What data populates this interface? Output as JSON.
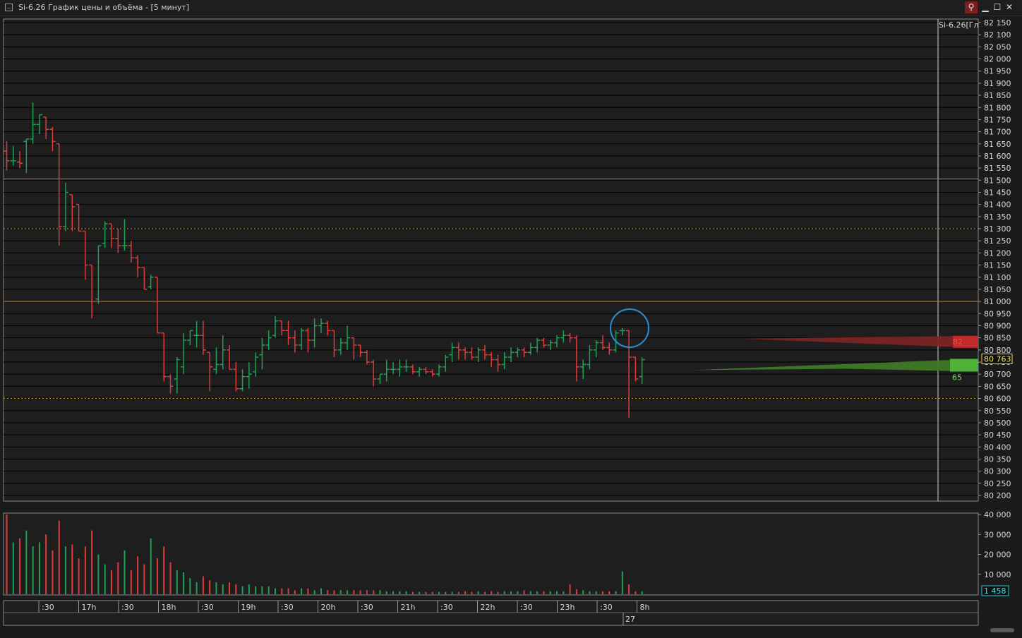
{
  "window": {
    "title": "Si-6.26 График цены и объёма - [5 минут]",
    "buttons": [
      "link-icon",
      "minimize-icon",
      "maximize-icon",
      "close-icon"
    ]
  },
  "colors": {
    "background": "#1b1b1b",
    "up": "#1fa055",
    "down": "#e03a3a",
    "level": "#c87a20",
    "dotted_level": "#d49a2a",
    "grid": "#000000",
    "price_tag_border": "#e8e040",
    "volume_tag": "#22c8d8",
    "circle": "#2a8fd6"
  },
  "chart_data": [
    {
      "type": "ohlc",
      "label": "Si-6.26[Гл",
      "ylim": [
        80200,
        82150
      ],
      "y_ticks": [
        "82 150",
        "82 100",
        "82 050",
        "82 000",
        "81 950",
        "81 900",
        "81 850",
        "81 800",
        "81 750",
        "81 700",
        "81 650",
        "81 600",
        "81 550",
        "81 500",
        "81 450",
        "81 400",
        "81 350",
        "81 300",
        "81 250",
        "81 200",
        "81 150",
        "81 100",
        "81 050",
        "81 000",
        "80 950",
        "80 900",
        "80 850",
        "80 800",
        "80 750",
        "80 700",
        "80 650",
        "80 600",
        "80 550",
        "80 500",
        "80 450",
        "80 400",
        "80 350",
        "80 300",
        "80 250",
        "80 200"
      ],
      "last_price": "80 763",
      "horizontal_levels": [
        {
          "price": 81505,
          "style": "solid"
        },
        {
          "price": 81000,
          "style": "solid"
        },
        {
          "price": 81300,
          "style": "dotted"
        },
        {
          "price": 80600,
          "style": "dotted"
        }
      ],
      "volume_profile": [
        {
          "label": "82",
          "side": "sell"
        },
        {
          "label": "65",
          "side": "buy"
        }
      ],
      "bars": [
        [
          81620,
          81660,
          81540,
          81580
        ],
        [
          81580,
          81640,
          81560,
          81580
        ],
        [
          81575,
          81620,
          81550,
          81570
        ],
        [
          81660,
          81670,
          81530,
          81670
        ],
        [
          81670,
          81820,
          81650,
          81730
        ],
        [
          81730,
          81770,
          81690,
          81770
        ],
        [
          81760,
          81760,
          81670,
          81710
        ],
        [
          81710,
          81720,
          81620,
          81660
        ],
        [
          81650,
          81650,
          81230,
          81310
        ],
        [
          81310,
          81490,
          81290,
          81450
        ],
        [
          81440,
          81440,
          81290,
          81390
        ],
        [
          81400,
          81400,
          81290,
          81290
        ],
        [
          81290,
          81290,
          81090,
          81150
        ],
        [
          81150,
          81150,
          80930,
          81000
        ],
        [
          81010,
          81230,
          80990,
          81230
        ],
        [
          81240,
          81330,
          81220,
          81320
        ],
        [
          81320,
          81320,
          81220,
          81260
        ],
        [
          81260,
          81300,
          81200,
          81230
        ],
        [
          81230,
          81340,
          81210,
          81230
        ],
        [
          81230,
          81250,
          81160,
          81180
        ],
        [
          81180,
          81190,
          81100,
          81140
        ],
        [
          81140,
          81140,
          81050,
          81050
        ],
        [
          81060,
          81110,
          81050,
          81100
        ],
        [
          81100,
          81100,
          80870,
          80870
        ],
        [
          80870,
          80870,
          80670,
          80690
        ],
        [
          80690,
          80700,
          80620,
          80650
        ],
        [
          80680,
          80770,
          80620,
          80760
        ],
        [
          80730,
          80870,
          80700,
          80840
        ],
        [
          80840,
          80880,
          80820,
          80880
        ],
        [
          80860,
          80920,
          80810,
          80860
        ],
        [
          80860,
          80920,
          80780,
          80800
        ],
        [
          80790,
          80790,
          80630,
          80730
        ],
        [
          80720,
          80810,
          80700,
          80740
        ],
        [
          80740,
          80860,
          80720,
          80800
        ],
        [
          80800,
          80820,
          80720,
          80720
        ],
        [
          80720,
          80750,
          80630,
          80640
        ],
        [
          80640,
          80720,
          80630,
          80690
        ],
        [
          80690,
          80750,
          80640,
          80700
        ],
        [
          80710,
          80790,
          80690,
          80770
        ],
        [
          80780,
          80850,
          80720,
          80820
        ],
        [
          80820,
          80880,
          80800,
          80850
        ],
        [
          80860,
          80940,
          80850,
          80920
        ],
        [
          80920,
          80920,
          80860,
          80880
        ],
        [
          80880,
          80920,
          80820,
          80850
        ],
        [
          80850,
          80880,
          80790,
          80820
        ],
        [
          80820,
          80890,
          80800,
          80880
        ],
        [
          80880,
          80890,
          80790,
          80840
        ],
        [
          80840,
          80930,
          80810,
          80900
        ],
        [
          80900,
          80930,
          80870,
          80910
        ],
        [
          80910,
          80920,
          80860,
          80880
        ],
        [
          80880,
          80880,
          80770,
          80800
        ],
        [
          80800,
          80850,
          80780,
          80830
        ],
        [
          80830,
          80900,
          80800,
          80850
        ],
        [
          80850,
          80850,
          80760,
          80820
        ],
        [
          80820,
          80820,
          80770,
          80790
        ],
        [
          80790,
          80800,
          80740,
          80750
        ],
        [
          80750,
          80760,
          80650,
          80680
        ],
        [
          80680,
          80700,
          80660,
          80700
        ],
        [
          80700,
          80760,
          80670,
          80720
        ],
        [
          80720,
          80750,
          80700,
          80720
        ],
        [
          80720,
          80760,
          80690,
          80730
        ],
        [
          80730,
          80760,
          80710,
          80730
        ],
        [
          80730,
          80740,
          80700,
          80710
        ],
        [
          80710,
          80730,
          80690,
          80720
        ],
        [
          80720,
          80730,
          80700,
          80710
        ],
        [
          80710,
          80720,
          80690,
          80700
        ],
        [
          80700,
          80740,
          80690,
          80730
        ],
        [
          80730,
          80780,
          80710,
          80770
        ],
        [
          80780,
          80830,
          80750,
          80810
        ],
        [
          80810,
          80830,
          80760,
          80800
        ],
        [
          80800,
          80810,
          80760,
          80790
        ],
        [
          80790,
          80810,
          80760,
          80770
        ],
        [
          80770,
          80810,
          80750,
          80800
        ],
        [
          80800,
          80820,
          80760,
          80780
        ],
        [
          80780,
          80790,
          80730,
          80760
        ],
        [
          80760,
          80780,
          80710,
          80740
        ],
        [
          80740,
          80790,
          80720,
          80770
        ],
        [
          80770,
          80810,
          80750,
          80790
        ],
        [
          80790,
          80810,
          80770,
          80800
        ],
        [
          80800,
          80810,
          80770,
          80790
        ],
        [
          80790,
          80830,
          80780,
          80810
        ],
        [
          80810,
          80850,
          80790,
          80840
        ],
        [
          80840,
          80850,
          80810,
          80820
        ],
        [
          80820,
          80840,
          80800,
          80830
        ],
        [
          80830,
          80860,
          80810,
          80850
        ],
        [
          80850,
          80880,
          80830,
          80860
        ],
        [
          80860,
          80870,
          80830,
          80850
        ],
        [
          80850,
          80860,
          80670,
          80730
        ],
        [
          80730,
          80760,
          80680,
          80740
        ],
        [
          80740,
          80820,
          80720,
          80800
        ],
        [
          80800,
          80840,
          80770,
          80830
        ],
        [
          80830,
          80860,
          80800,
          80810
        ],
        [
          80810,
          80830,
          80780,
          80800
        ],
        [
          80800,
          80880,
          80790,
          80870
        ],
        [
          80880,
          80890,
          80860,
          80880
        ],
        [
          80880,
          80880,
          80520,
          80770
        ],
        [
          80770,
          80770,
          80670,
          80680
        ],
        [
          80690,
          80770,
          80660,
          80760
        ]
      ],
      "volume": {
        "ylim": [
          0,
          40000
        ],
        "y_ticks": [
          "40 000",
          "30 000",
          "20 000",
          "10 000"
        ],
        "last_volume": "1 458"
      },
      "x_ticks": [
        ":30",
        "17h",
        ":30",
        "18h",
        ":30",
        "19h",
        ":30",
        "20h",
        ":30",
        "21h",
        ":30",
        "22h",
        ":30",
        "23h",
        ":30",
        "8h"
      ],
      "date_label": "27"
    }
  ]
}
